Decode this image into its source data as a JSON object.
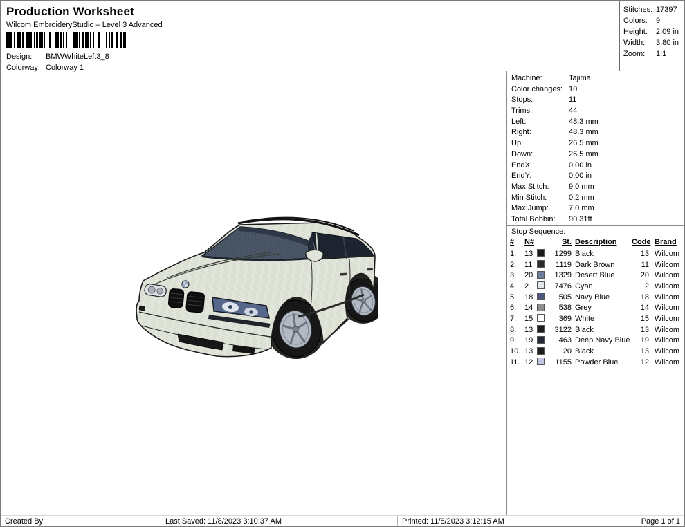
{
  "header": {
    "title": "Production Worksheet",
    "subtitle": "Wilcom EmbroideryStudio – Level 3 Advanced",
    "design_label": "Design:",
    "design_value": "BMWWhiteLeft3_8",
    "colorway_label": "Colorway:",
    "colorway_value": "Colorway 1",
    "stats": [
      {
        "label": "Stitches:",
        "value": "17397"
      },
      {
        "label": "Colors:",
        "value": "9"
      },
      {
        "label": "Height:",
        "value": "2.09 in"
      },
      {
        "label": "Width:",
        "value": "3.80 in"
      },
      {
        "label": "Zoom:",
        "value": "1:1"
      }
    ]
  },
  "machine_info": [
    {
      "label": "Machine:",
      "value": "Tajima"
    },
    {
      "label": "Color changes:",
      "value": "10"
    },
    {
      "label": "Stops:",
      "value": "11"
    },
    {
      "label": "Trims:",
      "value": "44"
    },
    {
      "label": "Left:",
      "value": "48.3 mm"
    },
    {
      "label": "Right:",
      "value": "48.3 mm"
    },
    {
      "label": "Up:",
      "value": "26.5 mm"
    },
    {
      "label": "Down:",
      "value": "26.5 mm"
    },
    {
      "label": "EndX:",
      "value": "0.00 in"
    },
    {
      "label": "EndY:",
      "value": "0.00 in"
    },
    {
      "label": "Max Stitch:",
      "value": "9.0 mm"
    },
    {
      "label": "Min Stitch:",
      "value": "0.2 mm"
    },
    {
      "label": "Max Jump:",
      "value": "7.0 mm"
    },
    {
      "label": "Total Bobbin:",
      "value": "90.31ft"
    }
  ],
  "stop_sequence": {
    "title": "Stop Sequence:",
    "columns": [
      "#",
      "N#",
      "St.",
      "Description",
      "Code",
      "Brand"
    ],
    "rows": [
      {
        "num": "1.",
        "n": "13",
        "swatch_color": "#1c1c1c",
        "st": "1299",
        "description": "Black",
        "code": "13",
        "brand": "Wilcom"
      },
      {
        "num": "2.",
        "n": "11",
        "swatch_color": "#2e2b27",
        "st": "1119",
        "description": "Dark Brown",
        "code": "11",
        "brand": "Wilcom"
      },
      {
        "num": "3.",
        "n": "20",
        "swatch_color": "#6e7c9e",
        "st": "1329",
        "description": "Desert Blue",
        "code": "20",
        "brand": "Wilcom"
      },
      {
        "num": "4.",
        "n": "2",
        "swatch_color": "#dfe7ea",
        "st": "7476",
        "description": "Cyan",
        "code": "2",
        "brand": "Wilcom"
      },
      {
        "num": "5.",
        "n": "18",
        "swatch_color": "#4b5878",
        "st": "505",
        "description": "Navy Blue",
        "code": "18",
        "brand": "Wilcom"
      },
      {
        "num": "6.",
        "n": "14",
        "swatch_color": "#8e8e8e",
        "st": "538",
        "description": "Grey",
        "code": "14",
        "brand": "Wilcom"
      },
      {
        "num": "7.",
        "n": "15",
        "swatch_color": "#ffffff",
        "st": "369",
        "description": "White",
        "code": "15",
        "brand": "Wilcom"
      },
      {
        "num": "8.",
        "n": "13",
        "swatch_color": "#1c1c1c",
        "st": "3122",
        "description": "Black",
        "code": "13",
        "brand": "Wilcom"
      },
      {
        "num": "9.",
        "n": "19",
        "swatch_color": "#262933",
        "st": "463",
        "description": "Deep Navy Blue",
        "code": "19",
        "brand": "Wilcom"
      },
      {
        "num": "10.",
        "n": "13",
        "swatch_color": "#1c1c1c",
        "st": "20",
        "description": "Black",
        "code": "13",
        "brand": "Wilcom"
      },
      {
        "num": "11.",
        "n": "12",
        "swatch_color": "#c4c7e3",
        "st": "1155",
        "description": "Powder Blue",
        "code": "12",
        "brand": "Wilcom"
      }
    ]
  },
  "design_preview": {
    "name": "BMW white station wagon embroidery design, front-left view",
    "body_color": "#e3e7db",
    "glass_color": "#455060",
    "wheel_rim_color": "#b3b9c3",
    "tire_color": "#171717"
  },
  "footer": {
    "created_by": "Created By:",
    "last_saved": "Last Saved: 11/8/2023 3:10:37 AM",
    "printed": "Printed: 11/8/2023 3:12:15 AM",
    "page": "Page 1 of 1"
  }
}
